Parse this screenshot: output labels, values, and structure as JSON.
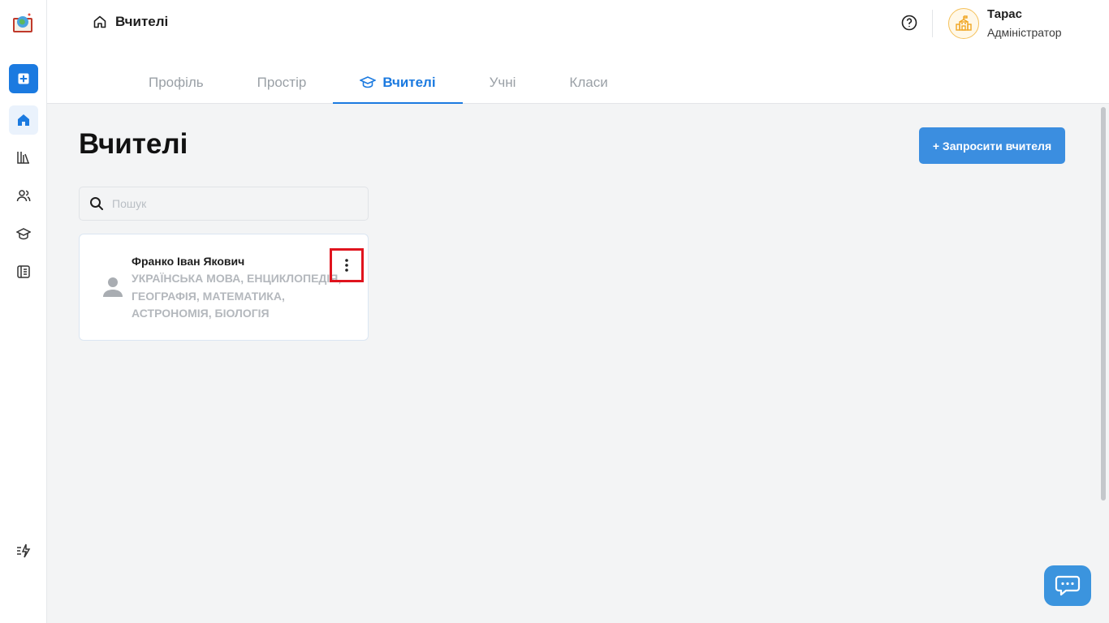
{
  "header": {
    "breadcrumb": "Вчителі",
    "user": {
      "name": "Тарас",
      "role": "Адміністратор"
    }
  },
  "tabs": [
    {
      "label": "Профіль",
      "active": false
    },
    {
      "label": "Простір",
      "active": false
    },
    {
      "label": "Вчителі",
      "active": true
    },
    {
      "label": "Учні",
      "active": false
    },
    {
      "label": "Класи",
      "active": false
    }
  ],
  "sidebar": {
    "items": [
      {
        "icon": "plus-square-icon"
      },
      {
        "icon": "home-icon"
      },
      {
        "icon": "library-icon"
      },
      {
        "icon": "users-icon"
      },
      {
        "icon": "graduation-cap-icon"
      },
      {
        "icon": "journal-icon"
      },
      {
        "icon": "updates-icon"
      }
    ]
  },
  "main": {
    "title": "Вчителі",
    "invite_button": "+ Запросити вчителя",
    "search_placeholder": "Пошук",
    "teachers": [
      {
        "name": "Франко Іван Якович",
        "subjects": "Українська мова, Енциклопедія, Географія, Математика, Астрономія, Біологія"
      }
    ]
  },
  "colors": {
    "accent": "#1b7ae0",
    "button": "#3b8ee0",
    "highlight": "#e0141e"
  }
}
